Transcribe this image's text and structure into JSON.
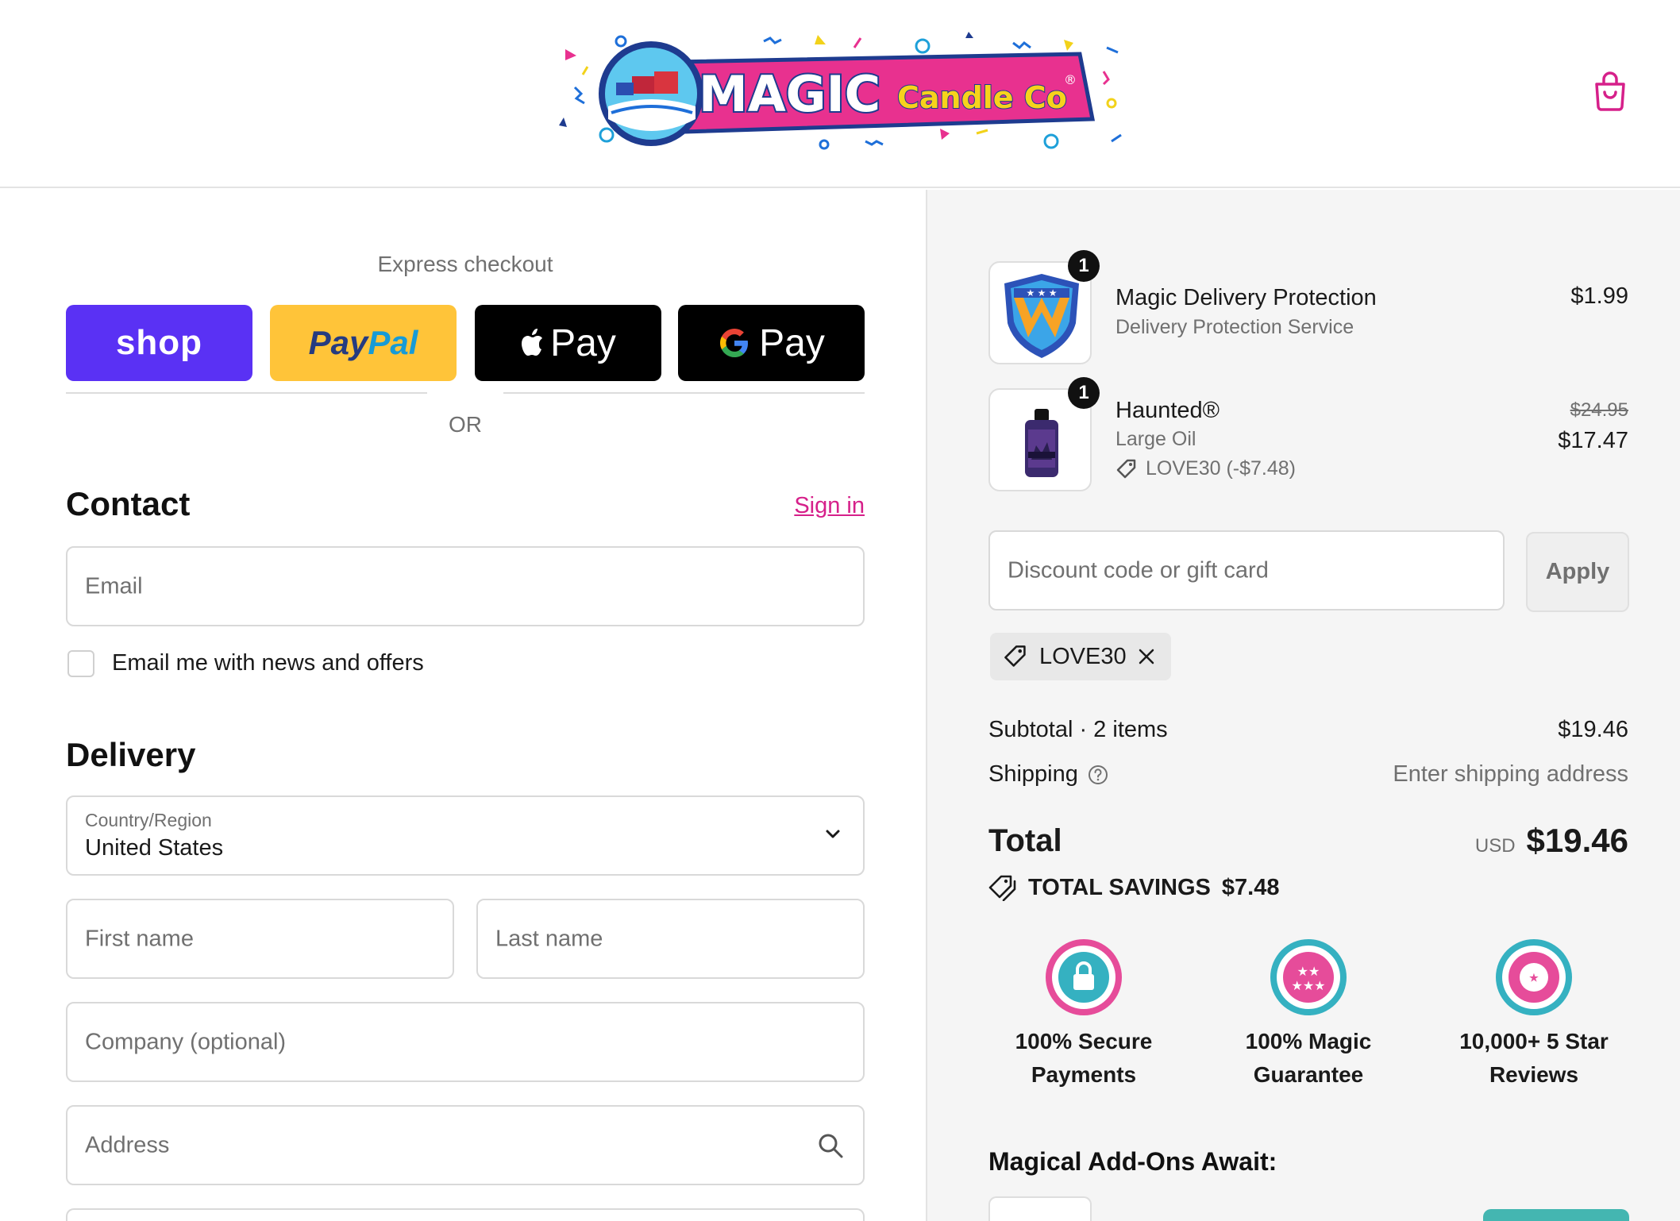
{
  "header": {
    "logo": {
      "brand": "MAGIC",
      "sub": "Candle Co",
      "mark": "®"
    },
    "cart_icon": "shopping-bag-icon"
  },
  "express": {
    "label": "Express checkout",
    "shop": "shop",
    "paypal_dark": "Pay",
    "paypal_light": "Pal",
    "apple": "Pay",
    "google": "Pay",
    "or": "OR"
  },
  "contact": {
    "title": "Contact",
    "sign_in": "Sign in",
    "email_placeholder": "Email",
    "news_label": "Email me with news and offers"
  },
  "delivery": {
    "title": "Delivery",
    "country_label": "Country/Region",
    "country_value": "United States",
    "first_name": "First name",
    "last_name": "Last name",
    "company": "Company (optional)",
    "address": "Address"
  },
  "cart": {
    "items": [
      {
        "qty": "1",
        "name": "Magic Delivery Protection",
        "variant": "Delivery Protection Service",
        "price": "$1.99"
      },
      {
        "qty": "1",
        "name": "Haunted®",
        "variant": "Large Oil",
        "discount": "LOVE30 (-$7.48)",
        "original_price": "$24.95",
        "price": "$17.47"
      }
    ],
    "discount_placeholder": "Discount code or gift card",
    "apply": "Apply",
    "applied_code": "LOVE30"
  },
  "summary": {
    "subtotal_label": "Subtotal · 2 items",
    "subtotal_value": "$19.46",
    "shipping_label": "Shipping",
    "shipping_value": "Enter shipping address",
    "total_label": "Total",
    "currency": "USD",
    "total_value": "$19.46",
    "savings_label": "TOTAL SAVINGS",
    "savings_value": "$7.48"
  },
  "badges": [
    {
      "line1": "100% Secure",
      "line2": "Payments"
    },
    {
      "line1": "100% Magic",
      "line2": "Guarantee"
    },
    {
      "line1": "10,000+ 5 Star",
      "line2": "Reviews"
    }
  ],
  "addons": {
    "title": "Magical Add-Ons Await:"
  },
  "colors": {
    "accent": "#d6208a",
    "shop": "#5a31f4",
    "paypal": "#ffc439",
    "addon_button": "#44b6b1"
  }
}
